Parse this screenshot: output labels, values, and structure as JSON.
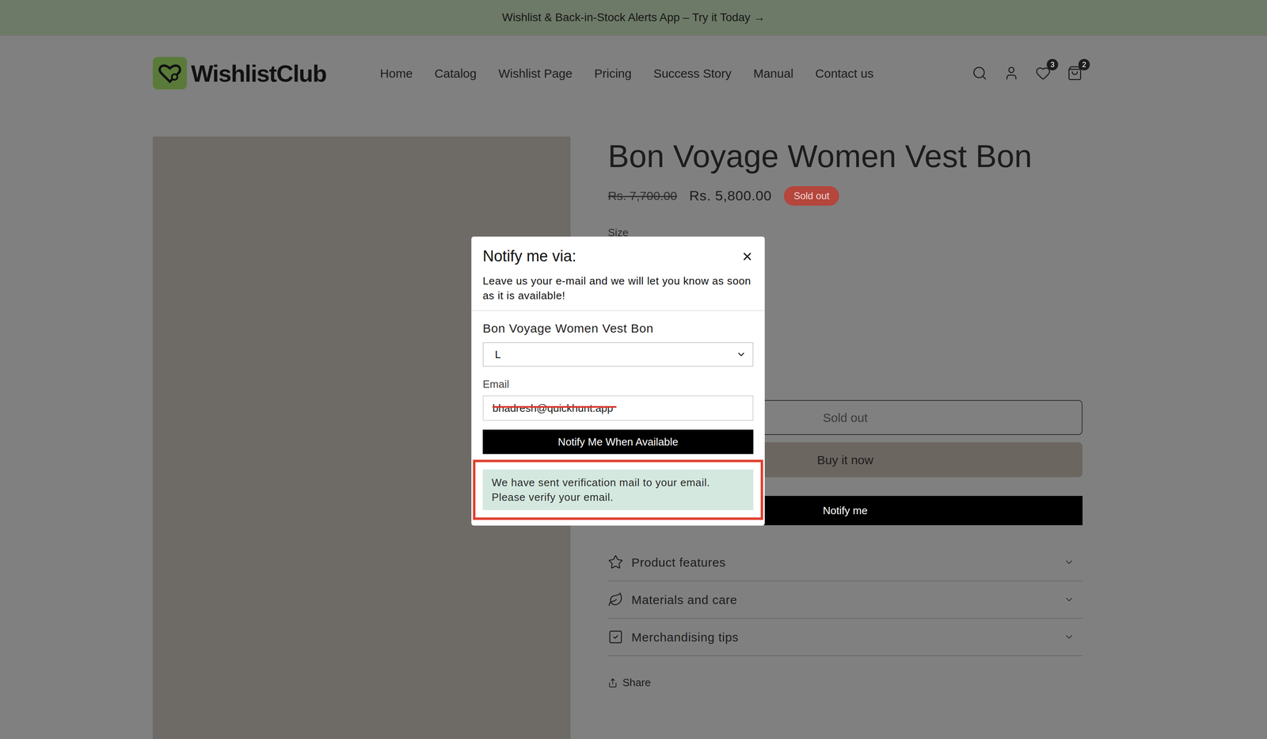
{
  "announcement": {
    "text": "Wishlist & Back-in-Stock Alerts App – Try it Today →"
  },
  "header": {
    "logo": "WishlistClub",
    "nav": [
      "Home",
      "Catalog",
      "Wishlist Page",
      "Pricing",
      "Success Story",
      "Manual",
      "Contact us"
    ],
    "wishlist_count": "3",
    "cart_count": "2"
  },
  "product": {
    "title": "Bon Voyage Women Vest Bon",
    "compare_price": "Rs. 7,700.00",
    "price": "Rs. 5,800.00",
    "badge": "Sold out",
    "option_label": "Size",
    "buttons": [
      {
        "label": "Sold out",
        "kind": "outline",
        "disabled": true
      },
      {
        "label": "Buy it now",
        "kind": "secondary",
        "disabled": false
      },
      {
        "label": "Notify me",
        "kind": "primary",
        "disabled": false
      }
    ],
    "accordions": [
      {
        "label": "Product features",
        "expanded": false
      },
      {
        "label": "Materials and care",
        "expanded": false
      },
      {
        "label": "Merchandising tips",
        "expanded": false
      }
    ],
    "share": "Share"
  },
  "modal": {
    "title": "Notify me via:",
    "description": "Leave us your e-mail and we will let you know as soon as it is available!",
    "product_name": "Bon Voyage Women Vest Bon",
    "variant": "L",
    "email_label": "Email",
    "email": "bhadresh@quickhunt.app",
    "email_redacted": true,
    "submit": "Notify Me When Available",
    "message": "We have sent verification mail to your email. Please verify your email.",
    "message_highlighted": true
  }
}
